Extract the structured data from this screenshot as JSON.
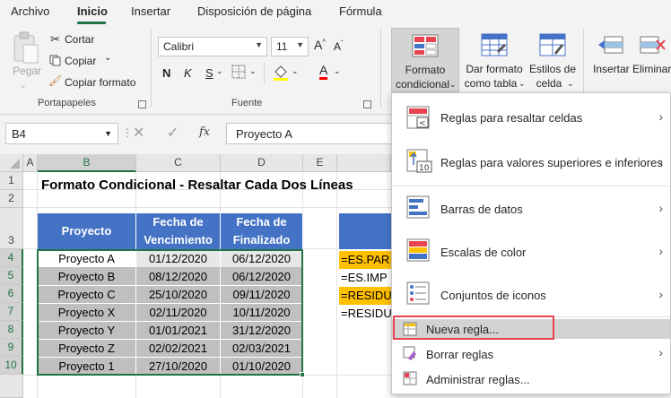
{
  "tabs": [
    {
      "label": "Archivo",
      "active": false
    },
    {
      "label": "Inicio",
      "active": true
    },
    {
      "label": "Insertar",
      "active": false
    },
    {
      "label": "Disposición de página",
      "active": false
    },
    {
      "label": "Fórmula",
      "active": false
    }
  ],
  "ribbon": {
    "clipboard": {
      "paste_label": "Pegar",
      "cut_label": "Cortar",
      "copy_label": "Copiar",
      "format_painter_label": "Copiar formato",
      "group_label": "Portapapeles"
    },
    "font": {
      "family": "Calibri",
      "size": "11",
      "bold": "N",
      "italic": "K",
      "underline": "S",
      "group_label": "Fuente"
    },
    "styles": {
      "conditional_label_1": "Formato",
      "conditional_label_2": "condicional",
      "format_table_1": "Dar formato",
      "format_table_2": "como tabla",
      "cell_styles_1": "Estilos de",
      "cell_styles_2": "celda"
    },
    "cells": {
      "insert_label": "Insertar",
      "delete_label": "Eliminar"
    }
  },
  "formula_bar": {
    "name_box": "B4",
    "fx": "fx",
    "content": "Proyecto A"
  },
  "columns": [
    "A",
    "B",
    "C",
    "D",
    "E"
  ],
  "rows": [
    "1",
    "2",
    "3",
    "4",
    "5",
    "6",
    "7",
    "8",
    "9",
    "10"
  ],
  "sheet": {
    "title": "Formato Condicional - Resaltar Cada Dos Líneas",
    "headers": [
      "Proyecto",
      "Fecha de Vencimiento",
      "Fecha de Finalizado"
    ],
    "data": [
      [
        "Proyecto A",
        "01/12/2020",
        "06/12/2020"
      ],
      [
        "Proyecto B",
        "08/12/2020",
        "06/12/2020"
      ],
      [
        "Proyecto C",
        "25/10/2020",
        "09/11/2020"
      ],
      [
        "Proyecto X",
        "02/11/2020",
        "10/11/2020"
      ],
      [
        "Proyecto Y",
        "01/01/2021",
        "31/12/2020"
      ],
      [
        "Proyecto Z",
        "02/02/2021",
        "02/03/2021"
      ],
      [
        "Proyecto 1",
        "27/10/2020",
        "01/10/2020"
      ]
    ],
    "formulas": [
      "=ES.PAR",
      "=ES.IMP",
      "=RESIDU",
      "=RESIDU"
    ]
  },
  "colors": {
    "header_blue": "#4472c4",
    "formula_yellow": "#ffc000",
    "excel_green": "#217346",
    "row_shade": "#bfbfbf",
    "highlight_red": "#e8434f"
  },
  "menu": {
    "items": [
      {
        "label": "Reglas para resaltar celdas",
        "icon": "highlight-rules-icon",
        "submenu": true
      },
      {
        "label": "Reglas para valores superiores e inferiores",
        "icon": "top-bottom-rules-icon",
        "submenu": true
      },
      {
        "label": "Barras de datos",
        "icon": "data-bars-icon",
        "submenu": true
      },
      {
        "label": "Escalas de color",
        "icon": "color-scales-icon",
        "submenu": true
      },
      {
        "label": "Conjuntos de iconos",
        "icon": "icon-sets-icon",
        "submenu": true
      }
    ],
    "new_rule": "Nueva regla...",
    "clear_rules": "Borrar reglas",
    "manage_rules": "Administrar reglas..."
  }
}
